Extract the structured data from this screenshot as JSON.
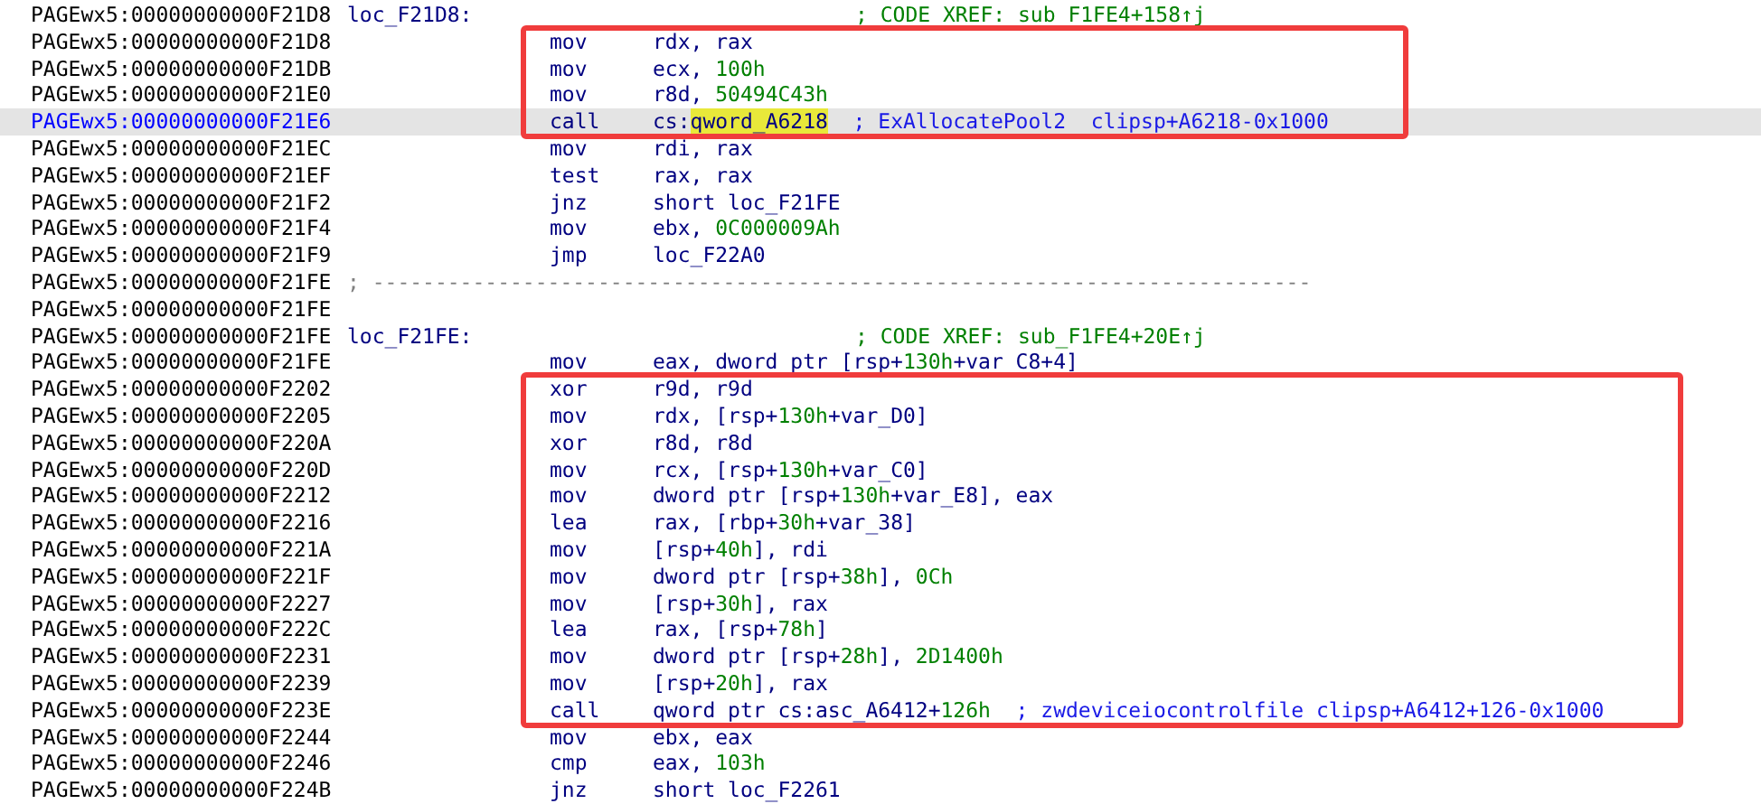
{
  "blocks": [
    {
      "boxed": false,
      "rows": [
        {
          "kind": "label",
          "address": "PAGEwx5:00000000000F21D8",
          "label": "loc_F21D8:",
          "comment": "; CODE XREF: sub_F1FE4+158↑j",
          "selected": false
        }
      ]
    },
    {
      "boxed": true,
      "rows": [
        {
          "kind": "instr",
          "address": "PAGEwx5:00000000000F21D8",
          "mnemonic": "mov",
          "operands": [
            {
              "text": "rdx, rax",
              "kind": "reg"
            }
          ],
          "selected": false
        },
        {
          "kind": "instr",
          "address": "PAGEwx5:00000000000F21DB",
          "mnemonic": "mov",
          "operands": [
            {
              "text": "ecx, ",
              "kind": "reg"
            },
            {
              "text": "100h",
              "kind": "num"
            }
          ],
          "selected": false
        },
        {
          "kind": "instr",
          "address": "PAGEwx5:00000000000F21E0",
          "mnemonic": "mov",
          "operands": [
            {
              "text": "r8d, ",
              "kind": "reg"
            },
            {
              "text": "50494C43h",
              "kind": "num"
            }
          ],
          "selected": false
        },
        {
          "kind": "instr",
          "address": "PAGEwx5:00000000000F21E6",
          "mnemonic": "call",
          "operands": [
            {
              "text": "cs:",
              "kind": "reg"
            },
            {
              "text": "qword_A6218",
              "kind": "highlight"
            }
          ],
          "comment": "; ExAllocatePool2  clipsp+A6218-0x1000",
          "selected": true
        }
      ]
    },
    {
      "boxed": false,
      "rows": [
        {
          "kind": "instr",
          "address": "PAGEwx5:00000000000F21EC",
          "mnemonic": "mov",
          "operands": [
            {
              "text": "rdi, rax",
              "kind": "reg"
            }
          ],
          "selected": false
        },
        {
          "kind": "instr",
          "address": "PAGEwx5:00000000000F21EF",
          "mnemonic": "test",
          "operands": [
            {
              "text": "rax, rax",
              "kind": "reg"
            }
          ],
          "selected": false
        },
        {
          "kind": "instr",
          "address": "PAGEwx5:00000000000F21F2",
          "mnemonic": "jnz",
          "operands": [
            {
              "text": "short loc_F21FE",
              "kind": "reg"
            }
          ],
          "selected": false
        },
        {
          "kind": "instr",
          "address": "PAGEwx5:00000000000F21F4",
          "mnemonic": "mov",
          "operands": [
            {
              "text": "ebx, ",
              "kind": "reg"
            },
            {
              "text": "0C000009Ah",
              "kind": "num"
            }
          ],
          "selected": false
        },
        {
          "kind": "instr",
          "address": "PAGEwx5:00000000000F21F9",
          "mnemonic": "jmp",
          "operands": [
            {
              "text": "loc_F22A0",
              "kind": "reg"
            }
          ],
          "selected": false
        },
        {
          "kind": "separator",
          "address": "PAGEwx5:00000000000F21FE",
          "text": "; ---------------------------------------------------------------------------",
          "selected": false
        },
        {
          "kind": "blank",
          "address": "PAGEwx5:00000000000F21FE",
          "selected": false
        },
        {
          "kind": "label",
          "address": "PAGEwx5:00000000000F21FE",
          "label": "loc_F21FE:",
          "comment": "; CODE XREF: sub_F1FE4+20E↑j",
          "selected": false
        },
        {
          "kind": "instr",
          "address": "PAGEwx5:00000000000F21FE",
          "mnemonic": "mov",
          "operands": [
            {
              "text": "eax, dword ptr [rsp+",
              "kind": "reg"
            },
            {
              "text": "130h",
              "kind": "num"
            },
            {
              "text": "+var_C8+4]",
              "kind": "reg"
            }
          ],
          "selected": false
        }
      ]
    },
    {
      "boxed": true,
      "rows": [
        {
          "kind": "instr",
          "address": "PAGEwx5:00000000000F2202",
          "mnemonic": "xor",
          "operands": [
            {
              "text": "r9d, r9d",
              "kind": "reg"
            }
          ],
          "selected": false
        },
        {
          "kind": "instr",
          "address": "PAGEwx5:00000000000F2205",
          "mnemonic": "mov",
          "operands": [
            {
              "text": "rdx, [rsp+",
              "kind": "reg"
            },
            {
              "text": "130h",
              "kind": "num"
            },
            {
              "text": "+var_D0]",
              "kind": "reg"
            }
          ],
          "selected": false
        },
        {
          "kind": "instr",
          "address": "PAGEwx5:00000000000F220A",
          "mnemonic": "xor",
          "operands": [
            {
              "text": "r8d, r8d",
              "kind": "reg"
            }
          ],
          "selected": false
        },
        {
          "kind": "instr",
          "address": "PAGEwx5:00000000000F220D",
          "mnemonic": "mov",
          "operands": [
            {
              "text": "rcx, [rsp+",
              "kind": "reg"
            },
            {
              "text": "130h",
              "kind": "num"
            },
            {
              "text": "+var_C0]",
              "kind": "reg"
            }
          ],
          "selected": false
        },
        {
          "kind": "instr",
          "address": "PAGEwx5:00000000000F2212",
          "mnemonic": "mov",
          "operands": [
            {
              "text": "dword ptr [rsp+",
              "kind": "reg"
            },
            {
              "text": "130h",
              "kind": "num"
            },
            {
              "text": "+var_E8], eax",
              "kind": "reg"
            }
          ],
          "selected": false
        },
        {
          "kind": "instr",
          "address": "PAGEwx5:00000000000F2216",
          "mnemonic": "lea",
          "operands": [
            {
              "text": "rax, [rbp+",
              "kind": "reg"
            },
            {
              "text": "30h",
              "kind": "num"
            },
            {
              "text": "+var_38]",
              "kind": "reg"
            }
          ],
          "selected": false
        },
        {
          "kind": "instr",
          "address": "PAGEwx5:00000000000F221A",
          "mnemonic": "mov",
          "operands": [
            {
              "text": "[rsp+",
              "kind": "reg"
            },
            {
              "text": "40h",
              "kind": "num"
            },
            {
              "text": "], rdi",
              "kind": "reg"
            }
          ],
          "selected": false
        },
        {
          "kind": "instr",
          "address": "PAGEwx5:00000000000F221F",
          "mnemonic": "mov",
          "operands": [
            {
              "text": "dword ptr [rsp+",
              "kind": "reg"
            },
            {
              "text": "38h",
              "kind": "num"
            },
            {
              "text": "], ",
              "kind": "reg"
            },
            {
              "text": "0Ch",
              "kind": "num"
            }
          ],
          "selected": false
        },
        {
          "kind": "instr",
          "address": "PAGEwx5:00000000000F2227",
          "mnemonic": "mov",
          "operands": [
            {
              "text": "[rsp+",
              "kind": "reg"
            },
            {
              "text": "30h",
              "kind": "num"
            },
            {
              "text": "], rax",
              "kind": "reg"
            }
          ],
          "selected": false
        },
        {
          "kind": "instr",
          "address": "PAGEwx5:00000000000F222C",
          "mnemonic": "lea",
          "operands": [
            {
              "text": "rax, [rsp+",
              "kind": "reg"
            },
            {
              "text": "78h",
              "kind": "num"
            },
            {
              "text": "]",
              "kind": "reg"
            }
          ],
          "selected": false
        },
        {
          "kind": "instr",
          "address": "PAGEwx5:00000000000F2231",
          "mnemonic": "mov",
          "operands": [
            {
              "text": "dword ptr [rsp+",
              "kind": "reg"
            },
            {
              "text": "28h",
              "kind": "num"
            },
            {
              "text": "], ",
              "kind": "reg"
            },
            {
              "text": "2D1400h",
              "kind": "num"
            }
          ],
          "selected": false
        },
        {
          "kind": "instr",
          "address": "PAGEwx5:00000000000F2239",
          "mnemonic": "mov",
          "operands": [
            {
              "text": "[rsp+",
              "kind": "reg"
            },
            {
              "text": "20h",
              "kind": "num"
            },
            {
              "text": "], rax",
              "kind": "reg"
            }
          ],
          "selected": false
        },
        {
          "kind": "instr",
          "address": "PAGEwx5:00000000000F223E",
          "mnemonic": "call",
          "operands": [
            {
              "text": "qword ptr cs:asc_A6412+",
              "kind": "reg"
            },
            {
              "text": "126h",
              "kind": "num"
            }
          ],
          "comment": "; zwdeviceiocontrolfile clipsp+A6412+126-0x1000",
          "selected": false
        }
      ]
    },
    {
      "boxed": false,
      "rows": [
        {
          "kind": "instr",
          "address": "PAGEwx5:00000000000F2244",
          "mnemonic": "mov",
          "operands": [
            {
              "text": "ebx, eax",
              "kind": "reg"
            }
          ],
          "selected": false
        },
        {
          "kind": "instr",
          "address": "PAGEwx5:00000000000F2246",
          "mnemonic": "cmp",
          "operands": [
            {
              "text": "eax, ",
              "kind": "reg"
            },
            {
              "text": "103h",
              "kind": "num"
            }
          ],
          "selected": false
        },
        {
          "kind": "instr",
          "address": "PAGEwx5:00000000000F224B",
          "mnemonic": "jnz",
          "operands": [
            {
              "text": "short loc_F2261",
              "kind": "reg"
            }
          ],
          "selected": false
        }
      ]
    }
  ]
}
